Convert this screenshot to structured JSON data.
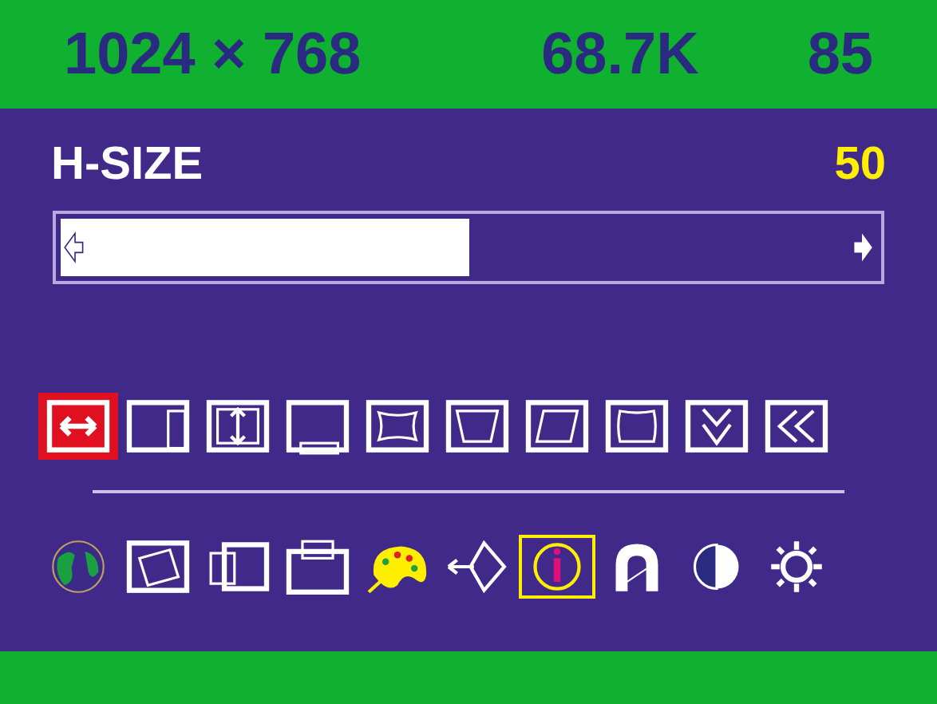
{
  "status_bar": {
    "resolution": "1024 × 768",
    "h_frequency": "68.7K",
    "v_frequency": "85"
  },
  "setting": {
    "label": "H-SIZE",
    "value": "50",
    "level": 0.5
  },
  "geometry_icons": [
    {
      "kind": "hsize",
      "selected": true
    },
    {
      "kind": "hpos",
      "selected": false
    },
    {
      "kind": "vsize",
      "selected": false
    },
    {
      "kind": "vpos",
      "selected": false
    },
    {
      "kind": "pincushion",
      "selected": false
    },
    {
      "kind": "trapezoid",
      "selected": false
    },
    {
      "kind": "parallelogram",
      "selected": false
    },
    {
      "kind": "pinbalance",
      "selected": false
    },
    {
      "kind": "moire",
      "selected": false
    },
    {
      "kind": "back",
      "selected": false
    }
  ],
  "menu_icons": [
    {
      "kind": "globe",
      "selected": false
    },
    {
      "kind": "rotation",
      "selected": false
    },
    {
      "kind": "position",
      "selected": false
    },
    {
      "kind": "size",
      "selected": false
    },
    {
      "kind": "palette",
      "selected": false
    },
    {
      "kind": "input",
      "selected": false
    },
    {
      "kind": "info",
      "selected": true
    },
    {
      "kind": "magnet",
      "selected": false
    },
    {
      "kind": "contrast",
      "selected": false
    },
    {
      "kind": "sun",
      "selected": false
    }
  ]
}
